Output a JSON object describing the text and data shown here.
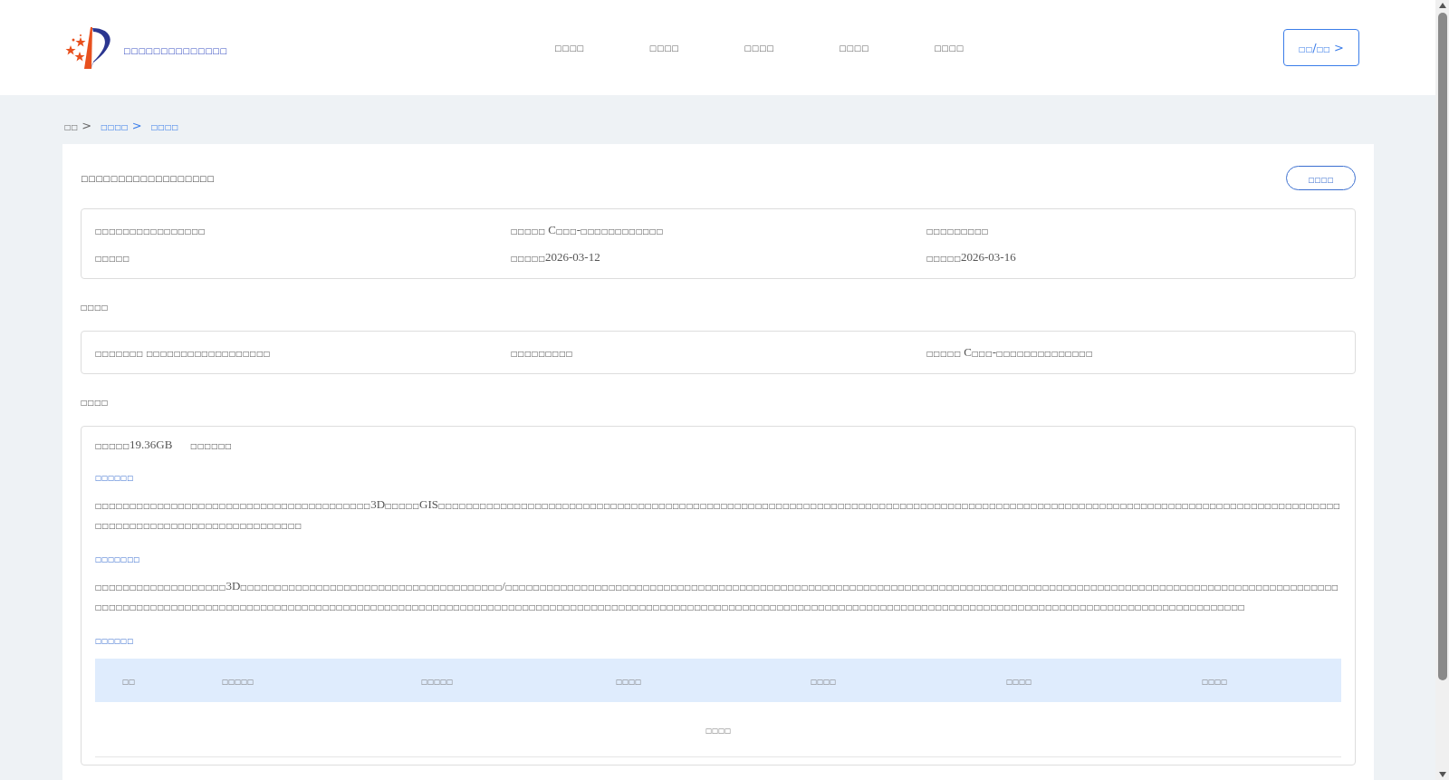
{
  "header": {
    "site_title": "□□□□□□□□□□□□□□",
    "nav": [
      "□□□□",
      "□□□□",
      "□□□□",
      "□□□□",
      "□□□□"
    ],
    "login_button": "□□/□□ >"
  },
  "breadcrumb": [
    {
      "label": "□□ >",
      "link": false
    },
    {
      "label": "□□□□ >",
      "link": true
    },
    {
      "label": "□□□□",
      "link": true
    }
  ],
  "detail": {
    "title": "□□□□□□□□□□□□□□□□□□",
    "action_button": "□□□□",
    "summary": [
      [
        "□□□□□□□□□□□□□□□□",
        "□□□□□ C□□□-□□□□□□□□□□□□",
        "□□□□□□□□□"
      ],
      [
        "□□□□□",
        "□□□□□2026-03-12",
        "□□□□□2026-03-16"
      ]
    ],
    "section_1": {
      "heading": "□□□□",
      "row": [
        "□□□□□□□ □□□□□□□□□□□□□□□□□□",
        "□□□□□□□□□",
        "□□□□□ C□□□-□□□□□□□□□□□□□□"
      ]
    },
    "section_2": {
      "heading": "□□□□",
      "size": "□□□□□19.36GB",
      "size_note": "□□□□□□",
      "blocks": [
        {
          "heading": "□□□□□□",
          "text": "□□□□□□□□□□□□□□□□□□□□□□□□□□□□□□□□□□□□□□□□3D□□□□□GIS□□□□□□□□□□□□□□□□□□□□□□□□□□□□□□□□□□□□□□□□□□□□□□□□□□□□□□□□□□□□□□□□□□□□□□□□□□□□□□□□□□□□□□□□□□□□□□□□□□□□□□□□□□□□□□□□□□□□□□□□□□□□□□□□□□□□□□□□□□□□□□□□□□□□□□□□□□□□□□□□□"
        },
        {
          "heading": "□□□□□□□",
          "text": "□□□□□□□□□□□□□□□□□□□3D□□□□□□□□□□□□□□□□□□□□□□□□□□□□□□□□□□□□□□/□□□□□□□□□□□□□□□□□□□□□□□□□□□□□□□□□□□□□□□□□□□□□□□□□□□□□□□□□□□□□□□□□□□□□□□□□□□□□□□□□□□□□□□□□□□□□□□□□□□□□□□□□□□□□□□□□□□□□□□□□□□□□□□□□□□□□□□□□□□□□□□□□□□□□□□□□□□□□□□□□□□□□□□□□□□□□□□□□□□□□□□□□□□□□□□□□□□□□□□□□□□□□□□□□□□□□□□□□□□□□□□□□□□□□□□□□□□□□□□□□□□□□□□□□□□□□□□□□□□□□□□□□□□□□□□□□□□□□□□□□□□□□□□□"
        }
      ],
      "table_heading": "□□□□□□",
      "columns": [
        "□□",
        "□□□□□",
        "□□□□□",
        "□□□□",
        "□□□□",
        "□□□□",
        "□□□□"
      ],
      "empty_text": "□□□□"
    }
  }
}
